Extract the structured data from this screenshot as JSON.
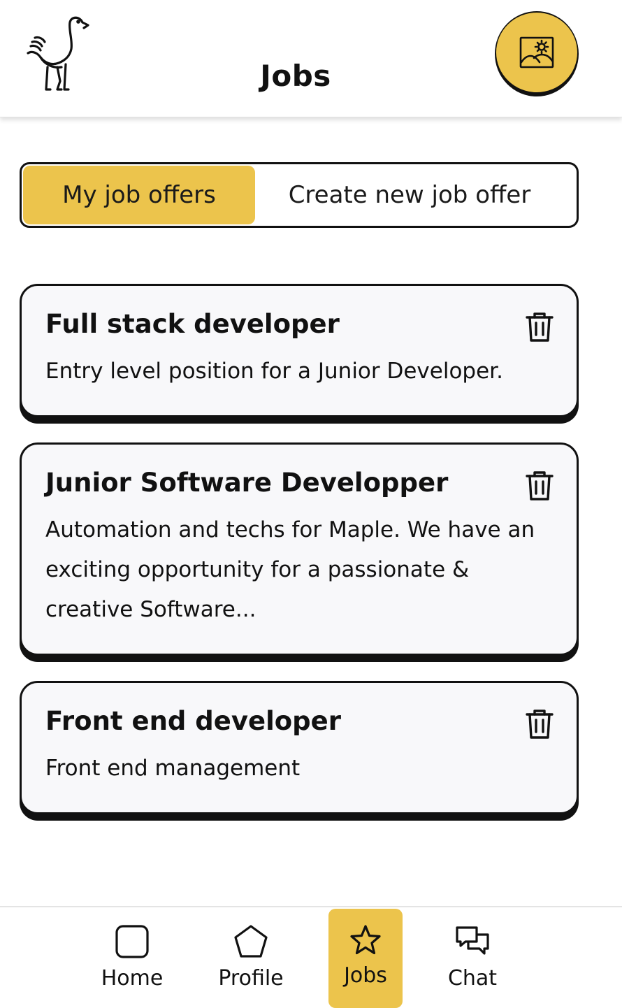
{
  "header": {
    "title": "Jobs",
    "logo_icon": "ostrich-logo-icon",
    "avatar_icon": "image-placeholder-icon"
  },
  "tabs": {
    "my_offers": "My job offers",
    "create_new": "Create new job offer",
    "active": "my_offers"
  },
  "jobs": [
    {
      "title": "Full stack developer",
      "description": "Entry level position for a Junior Developer."
    },
    {
      "title": "Junior Software Developper",
      "description": "Automation and techs for Maple. We have an exciting opportunity for a passionate & creative Software..."
    },
    {
      "title": "Front end developer",
      "description": "Front end management"
    }
  ],
  "nav": {
    "home": "Home",
    "profile": "Profile",
    "jobs": "Jobs",
    "chat": "Chat",
    "active": "jobs"
  },
  "colors": {
    "accent": "#ecc44c",
    "card_bg": "#f8f8fa",
    "ink": "#111111"
  }
}
